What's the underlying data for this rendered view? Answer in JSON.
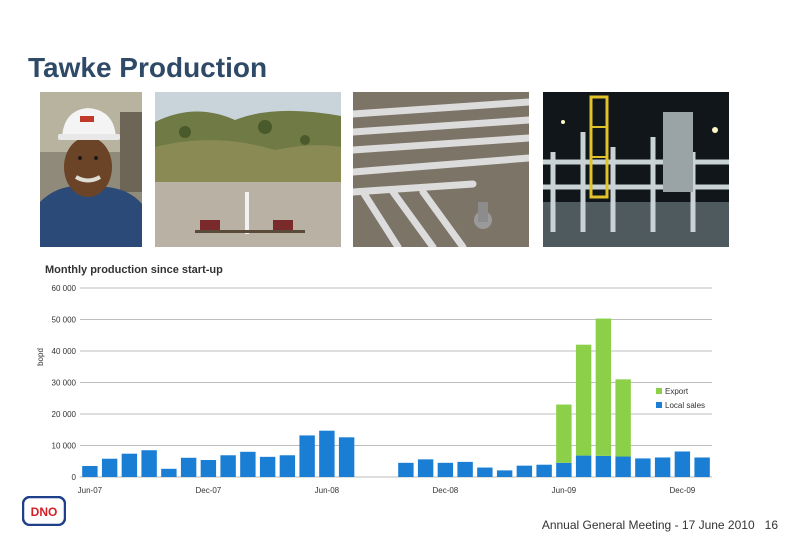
{
  "title": "Tawke Production",
  "footer": {
    "text": "Annual General Meeting - 17 June 2010",
    "page": "16"
  },
  "logo": {
    "text": "DNO",
    "color": "#d21f26"
  },
  "colors": {
    "title": "#2f4a66",
    "local": "#1a7fd4",
    "export": "#8cd04a",
    "grid": "#bdbdbd"
  },
  "chart_data": {
    "type": "bar",
    "stacked": true,
    "title": "Monthly production since start-up",
    "ylabel": "bopd",
    "xlabel": "",
    "ylim": [
      0,
      60000
    ],
    "yticks": [
      0,
      10000,
      20000,
      30000,
      40000,
      50000,
      60000
    ],
    "ytick_labels": [
      "0",
      "10 000",
      "20 000",
      "30 000",
      "40 000",
      "50 000",
      "60 000"
    ],
    "grid": true,
    "legend_position": "right",
    "categories": [
      "Jun-07",
      "Jul-07",
      "Aug-07",
      "Sep-07",
      "Oct-07",
      "Nov-07",
      "Dec-07",
      "Jan-08",
      "Feb-08",
      "Mar-08",
      "Apr-08",
      "May-08",
      "Jun-08",
      "Jul-08",
      "Aug-08",
      "Sep-08",
      "Oct-08",
      "Nov-08",
      "Dec-08",
      "Jan-09",
      "Feb-09",
      "Mar-09",
      "Apr-09",
      "May-09",
      "Jun-09",
      "Jul-09",
      "Aug-09",
      "Sep-09",
      "Oct-09",
      "Nov-09",
      "Dec-09",
      "Jan-10"
    ],
    "xtick_labels": [
      {
        "index": 0,
        "label": "Jun-07"
      },
      {
        "index": 6,
        "label": "Dec-07"
      },
      {
        "index": 12,
        "label": "Jun-08"
      },
      {
        "index": 18,
        "label": "Dec-08"
      },
      {
        "index": 24,
        "label": "Jun-09"
      },
      {
        "index": 30,
        "label": "Dec-09"
      }
    ],
    "series": [
      {
        "name": "Local sales",
        "color": "#1a7fd4",
        "values": [
          3500,
          5800,
          7400,
          8500,
          2600,
          6100,
          5400,
          6900,
          8000,
          6400,
          6900,
          13200,
          14700,
          12600,
          0,
          0,
          4500,
          5600,
          4500,
          4800,
          3000,
          2100,
          3600,
          3900,
          4500,
          6800,
          6700,
          6500,
          5900,
          6200,
          8100,
          6200
        ]
      },
      {
        "name": "Export",
        "color": "#8cd04a",
        "values": [
          0,
          0,
          0,
          0,
          0,
          0,
          0,
          0,
          0,
          0,
          0,
          0,
          0,
          0,
          0,
          0,
          0,
          0,
          0,
          0,
          0,
          0,
          0,
          0,
          18500,
          35200,
          43600,
          24500,
          0,
          0,
          0,
          0
        ]
      }
    ],
    "legend": [
      "Export",
      "Local sales"
    ]
  }
}
